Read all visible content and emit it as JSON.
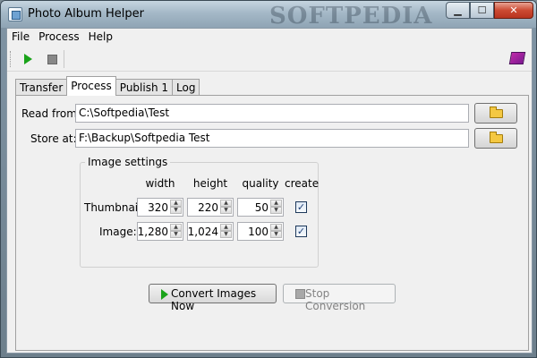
{
  "window": {
    "title": "Photo Album Helper",
    "bg_word": "SOFTPEDIA",
    "buttons": {
      "minimize": "▁",
      "maximize": "☐",
      "close": "✕"
    }
  },
  "menu": [
    "File",
    "Process",
    "Help"
  ],
  "toolbar": {
    "icons": [
      "play-icon",
      "stop-icon",
      "help-book-icon"
    ]
  },
  "tabs": [
    {
      "label": "Transfer",
      "active": false
    },
    {
      "label": "Process",
      "active": true
    },
    {
      "label": "Publish 1",
      "active": false
    },
    {
      "label": "Log",
      "active": false
    }
  ],
  "process": {
    "read_from": {
      "label": "Read from:",
      "value": "C:\\Softpedia\\Test"
    },
    "store_at": {
      "label": "Store at:",
      "value": "F:\\Backup\\Softpedia Test"
    },
    "image_settings": {
      "title": "Image settings",
      "columns": [
        "width",
        "height",
        "quality",
        "create"
      ],
      "rows": [
        {
          "label": "Thumbnail:",
          "width": "320",
          "height": "220",
          "quality": "50",
          "create": true
        },
        {
          "label": "Image:",
          "width": "1,280",
          "height": "1,024",
          "quality": "100",
          "create": true
        }
      ]
    },
    "convert_button": "Convert Images Now",
    "stop_button": "Stop Conversion"
  },
  "spin_arrows": {
    "up": "▲",
    "down": "▼"
  },
  "checkmark": "✓",
  "colors": {
    "title_bar": "#a4b8c7",
    "play_green": "#1aa31a",
    "close_red": "#cc4a32",
    "client_bg": "#f0f0f0"
  }
}
